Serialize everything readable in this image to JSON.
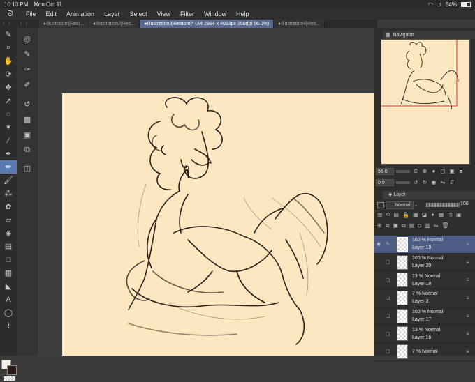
{
  "status": {
    "time": "10:13 PM",
    "date": "Mon Oct 11",
    "battery": "54%"
  },
  "menu": [
    "File",
    "Edit",
    "Animation",
    "Layer",
    "Select",
    "View",
    "Filter",
    "Window",
    "Help"
  ],
  "tabs": [
    {
      "label": "Illustration[Resi...",
      "active": false
    },
    {
      "label": "Illustration2[Res...",
      "active": false
    },
    {
      "label": "Illustration3[Restore]* (A4 2894 x 4093px 350dpi 56.0%)",
      "active": true
    },
    {
      "label": "Illustration4[Res...",
      "active": false
    }
  ],
  "navigator": {
    "title": "Navigator",
    "zoom": "56.0",
    "rotation": "0.0"
  },
  "layer_panel": {
    "title": "Layer",
    "blend_mode": "Normal",
    "opacity": "100"
  },
  "layers": [
    {
      "opacity_mode": "100 % Normal",
      "name": "Layer 19",
      "selected": true,
      "visible": true
    },
    {
      "opacity_mode": "100 % Normal",
      "name": "Layer 20",
      "selected": false,
      "visible": false
    },
    {
      "opacity_mode": "13 % Normal",
      "name": "Layer 18",
      "selected": false,
      "visible": false
    },
    {
      "opacity_mode": "7 % Normal",
      "name": "Layer 3",
      "selected": false,
      "visible": false
    },
    {
      "opacity_mode": "100 % Normal",
      "name": "Layer 17",
      "selected": false,
      "visible": false
    },
    {
      "opacity_mode": "13 % Normal",
      "name": "Layer 16",
      "selected": false,
      "visible": false
    },
    {
      "opacity_mode": "7 % Normal",
      "name": "",
      "selected": false,
      "visible": false
    }
  ],
  "colors": {
    "main": "#f4f0ea",
    "sub": "#2a1a1a",
    "accent": "#5979b3",
    "paper": "#fde7c0"
  }
}
